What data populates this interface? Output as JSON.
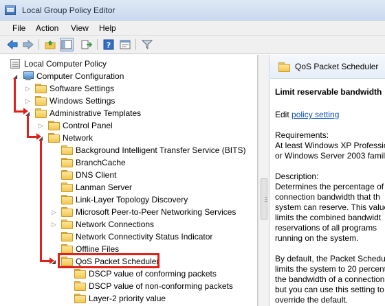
{
  "window": {
    "title": "Local Group Policy Editor"
  },
  "menu": [
    "File",
    "Action",
    "View",
    "Help"
  ],
  "toolbar": {
    "icons": [
      "back-icon",
      "forward-icon",
      "up-folder-icon",
      "show-hide-tree-icon",
      "export-list-icon",
      "help-icon",
      "properties-icon",
      "filter-icon"
    ]
  },
  "tree": {
    "root": "Local Computer Policy",
    "computer_config": "Computer Configuration",
    "software_settings": "Software Settings",
    "windows_settings": "Windows Settings",
    "admin_templates": "Administrative Templates",
    "control_panel": "Control Panel",
    "network": "Network",
    "network_children": [
      "Background Intelligent Transfer Service (BITS)",
      "BranchCache",
      "DNS Client",
      "Lanman Server",
      "Link-Layer Topology Discovery",
      "Microsoft Peer-to-Peer Networking Services",
      "Network Connections",
      "Network Connectivity Status Indicator",
      "Offline Files",
      "QoS Packet Scheduler"
    ],
    "qos_children": [
      "DSCP value of conforming packets",
      "DSCP value of non-conforming packets",
      "Layer-2 priority value"
    ]
  },
  "details": {
    "header": "QoS Packet Scheduler",
    "setting_title": "Limit reservable bandwidth",
    "edit_prefix": "Edit",
    "edit_link": "policy setting",
    "requirements_label": "Requirements:",
    "requirements_lines": [
      "At least Windows XP Professio",
      "or Windows Server 2003 family"
    ],
    "description_label": "Description:",
    "description_lines": [
      "Determines the percentage of",
      "connection bandwidth that th",
      "system can reserve. This value",
      "limits the combined bandwidt",
      "reservations of all programs",
      "running on the system."
    ],
    "default_lines": [
      "By default, the Packet Schedul",
      "limits the system to 20 percent",
      "the bandwidth of a connection",
      "but you can use this setting to",
      "override the default."
    ]
  },
  "colors": {
    "annotation": "#e0201a",
    "link": "#0b4fb5"
  }
}
